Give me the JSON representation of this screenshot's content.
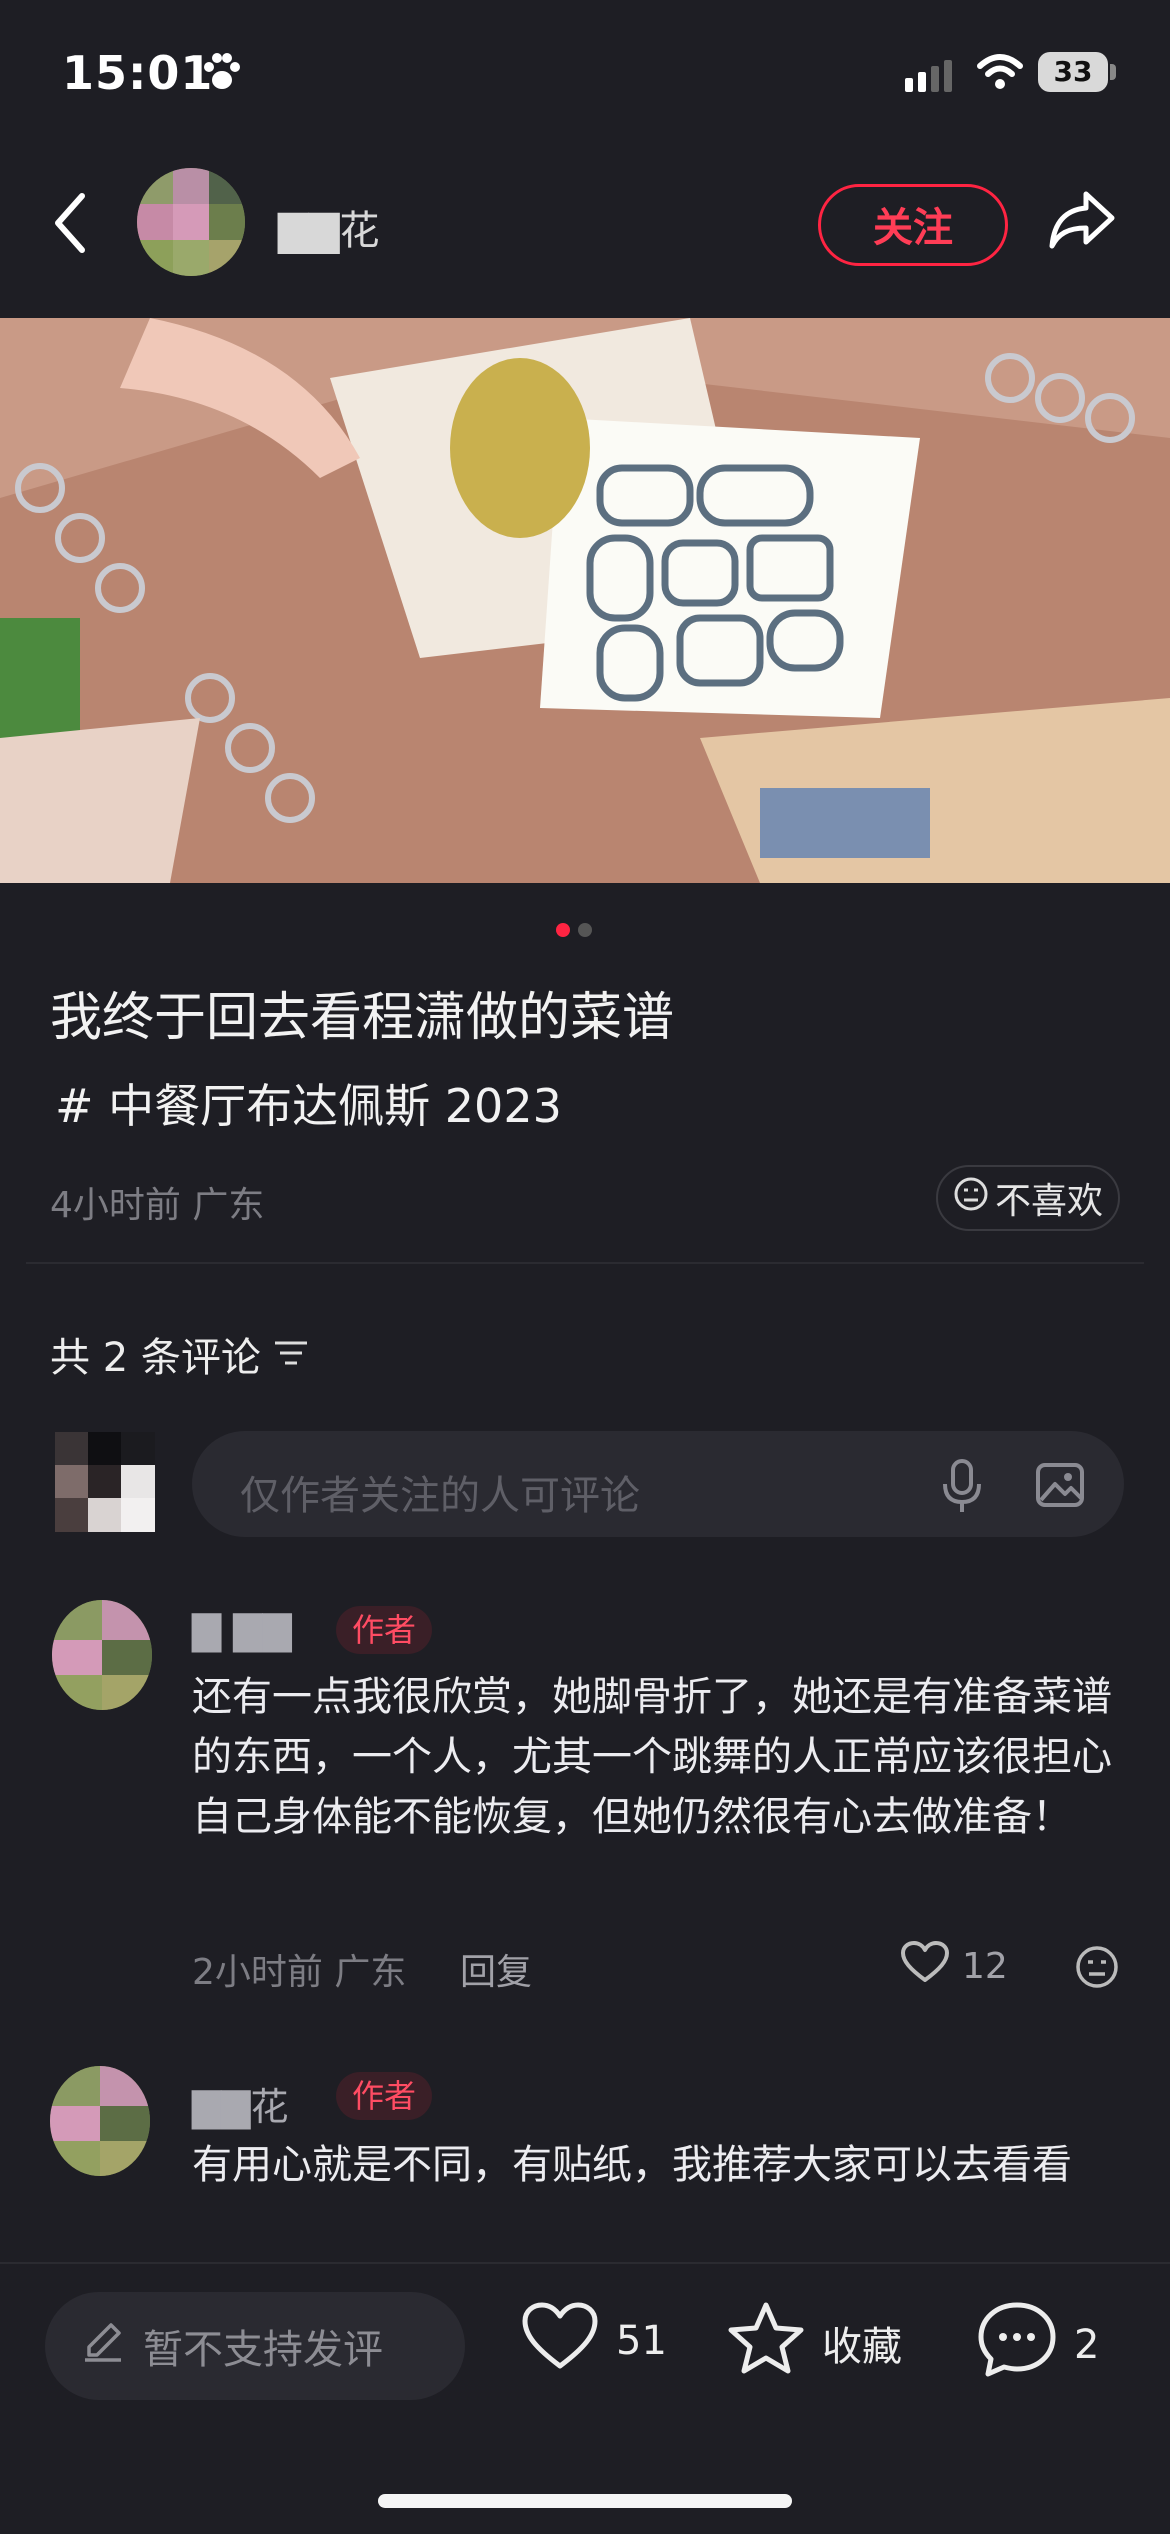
{
  "status_bar": {
    "time": "15:01",
    "battery": "33"
  },
  "header": {
    "username": "▇▇花",
    "follow_label": "关注"
  },
  "post": {
    "title": "我终于回去看程潇做的菜谱",
    "tag": "# 中餐厅布达佩斯 2023",
    "meta": "4小时前 广东",
    "dislike_label": "不喜欢"
  },
  "comments_section": {
    "count_label": "共 2 条评论",
    "input_placeholder": "仅作者关注的人可评论",
    "items": [
      {
        "name": "▇ ▇▇",
        "badge": "作者",
        "text": "还有一点我很欣赏，她脚骨折了，她还是有准备菜谱的东西，一个人，尤其一个跳舞的人正常应该很担心自己身体能不能恢复，但她仍然很有心去做准备！",
        "meta": "2小时前 广东",
        "reply_label": "回复",
        "likes": "12"
      },
      {
        "name": "▇▇花",
        "badge": "作者",
        "text": "有用心就是不同，有贴纸，我推荐大家可以去看看"
      }
    ]
  },
  "bottom_bar": {
    "compose_label": "暂不支持发评",
    "likes": "51",
    "collect_label": "收藏",
    "comments": "2"
  },
  "colors": {
    "accent": "#ff2442",
    "background": "#1e1e24"
  },
  "icons": [
    "paw-icon",
    "signal-icon",
    "wifi-icon",
    "battery-icon",
    "back-icon",
    "share-icon",
    "dislike-face-icon",
    "sort-icon",
    "mic-icon",
    "image-icon",
    "heart-icon",
    "more-face-icon",
    "pencil-icon",
    "star-icon",
    "comment-bubble-icon"
  ]
}
